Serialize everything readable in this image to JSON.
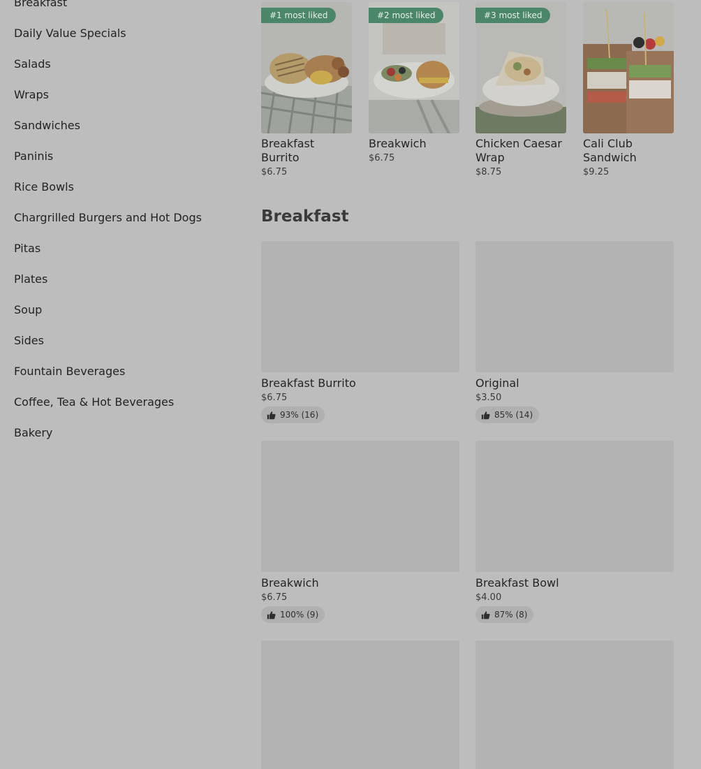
{
  "sidebar": {
    "items": [
      {
        "label": "Breakfast"
      },
      {
        "label": "Daily Value Specials"
      },
      {
        "label": "Salads"
      },
      {
        "label": "Wraps"
      },
      {
        "label": "Sandwiches"
      },
      {
        "label": "Paninis"
      },
      {
        "label": "Rice Bowls"
      },
      {
        "label": "Chargrilled Burgers and Hot Dogs"
      },
      {
        "label": "Pitas"
      },
      {
        "label": "Plates"
      },
      {
        "label": "Soup"
      },
      {
        "label": "Sides"
      },
      {
        "label": "Fountain Beverages"
      },
      {
        "label": "Coffee, Tea & Hot Beverages"
      },
      {
        "label": "Bakery"
      }
    ]
  },
  "popular": [
    {
      "badge": "#1 most liked",
      "name": "Breakfast Burrito",
      "price": "$6.75",
      "image_icon": "breakfast-burrito-photo"
    },
    {
      "badge": "#2 most liked",
      "name": "Breakwich",
      "price": "$6.75",
      "image_icon": "breakwich-photo"
    },
    {
      "badge": "#3 most liked",
      "name": "Chicken Caesar Wrap",
      "price": "$8.75",
      "image_icon": "chicken-caesar-wrap-photo"
    },
    {
      "badge": "",
      "name": "Cali Club Sandwich",
      "price": "$9.25",
      "image_icon": "cali-club-sandwich-photo"
    }
  ],
  "section": {
    "title": "Breakfast"
  },
  "items": [
    {
      "name": "Breakfast Burrito",
      "price": "$6.75",
      "rating": "93% (16)"
    },
    {
      "name": "Original",
      "price": "$3.50",
      "rating": "85% (14)"
    },
    {
      "name": "Breakwich",
      "price": "$6.75",
      "rating": "100% (9)"
    },
    {
      "name": "Breakfast Bowl",
      "price": "$4.00",
      "rating": "87% (8)"
    },
    {
      "name": "",
      "price": "",
      "rating": ""
    },
    {
      "name": "",
      "price": "",
      "rating": ""
    }
  ],
  "colors": {
    "overlay_background": "#bdbdbd",
    "badge_green": "#4b8668",
    "placeholder": "#b3b3b3"
  },
  "icons": {
    "rating": "thumbs-up-icon"
  }
}
